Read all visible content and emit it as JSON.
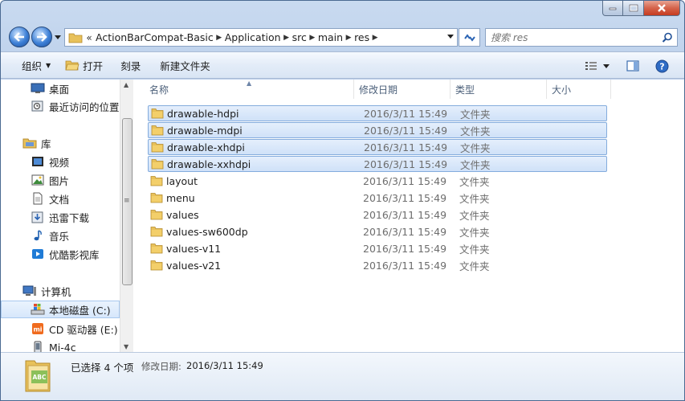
{
  "window": {
    "caption": {
      "minimize": "minimize",
      "maximize": "maximize",
      "close": "close"
    }
  },
  "address": {
    "overflow": "«",
    "breadcrumbs": [
      "ActionBarCompat-Basic",
      "Application",
      "src",
      "main",
      "res"
    ],
    "search_placeholder": "搜索 res"
  },
  "toolbar": {
    "organize": "组织",
    "open": "打开",
    "burn": "刻录",
    "new_folder": "新建文件夹"
  },
  "sidebar": {
    "desktop": "桌面",
    "recent": "最近访问的位置",
    "libraries": "库",
    "videos": "视频",
    "pictures": "图片",
    "documents": "文档",
    "thunder": "迅雷下载",
    "music": "音乐",
    "youku": "优酷影视库",
    "computer": "计算机",
    "local_disk": "本地磁盘 (C:)",
    "cd_drive": "CD 驱动器 (E:) X",
    "phone": "Mi-4c"
  },
  "columns": {
    "name": "名称",
    "modified": "修改日期",
    "type": "类型",
    "size": "大小"
  },
  "files": [
    {
      "name": "drawable-hdpi",
      "date": "2016/3/11 15:49",
      "type": "文件夹",
      "selected": true
    },
    {
      "name": "drawable-mdpi",
      "date": "2016/3/11 15:49",
      "type": "文件夹",
      "selected": true
    },
    {
      "name": "drawable-xhdpi",
      "date": "2016/3/11 15:49",
      "type": "文件夹",
      "selected": true
    },
    {
      "name": "drawable-xxhdpi",
      "date": "2016/3/11 15:49",
      "type": "文件夹",
      "selected": true
    },
    {
      "name": "layout",
      "date": "2016/3/11 15:49",
      "type": "文件夹",
      "selected": false
    },
    {
      "name": "menu",
      "date": "2016/3/11 15:49",
      "type": "文件夹",
      "selected": false
    },
    {
      "name": "values",
      "date": "2016/3/11 15:49",
      "type": "文件夹",
      "selected": false
    },
    {
      "name": "values-sw600dp",
      "date": "2016/3/11 15:49",
      "type": "文件夹",
      "selected": false
    },
    {
      "name": "values-v11",
      "date": "2016/3/11 15:49",
      "type": "文件夹",
      "selected": false
    },
    {
      "name": "values-v21",
      "date": "2016/3/11 15:49",
      "type": "文件夹",
      "selected": false
    }
  ],
  "details": {
    "count": "已选择 4 个项",
    "date_label": "修改日期:",
    "date": "2016/3/11 15:49",
    "icon_text": "ABC"
  },
  "colors": {
    "selection_fill": "#cfe1f8",
    "selection_border": "#84acdd",
    "folder": "#e8c15a"
  }
}
